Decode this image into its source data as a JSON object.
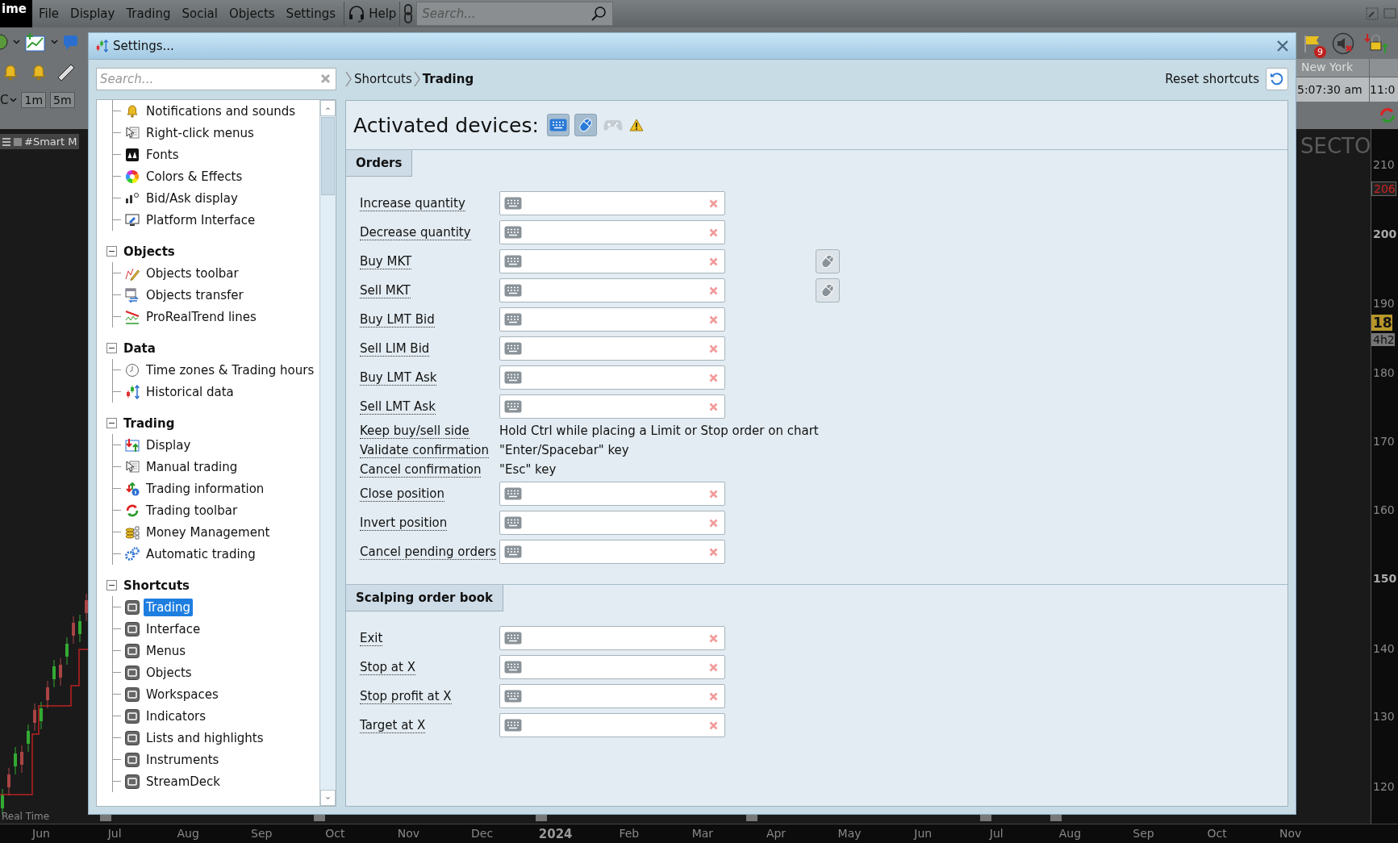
{
  "app": {
    "logo": "ime",
    "menu": [
      "File",
      "Display",
      "Trading",
      "Social",
      "Objects",
      "Settings"
    ],
    "help": "Help",
    "search": {
      "placeholder": "Search..."
    }
  },
  "toolbar": {
    "selector": "C",
    "timeframes": [
      "1m",
      "5m"
    ],
    "chart_name": "#Smart M"
  },
  "market_clock": {
    "badge": "9",
    "city": "New York",
    "time": "5:07:30 am",
    "time_2": "11:0"
  },
  "chart": {
    "watermark": "SECTO",
    "status": "Real Time",
    "price_labels": [
      {
        "kind": "tick",
        "label": "210"
      },
      {
        "kind": "marker",
        "label": "206"
      },
      {
        "kind": "major",
        "label": "200"
      },
      {
        "kind": "tick",
        "label": "190"
      },
      {
        "kind": "last",
        "label": "18"
      },
      {
        "kind": "timer",
        "label": "4h2"
      },
      {
        "kind": "tick",
        "label": "180"
      },
      {
        "kind": "tick",
        "label": "170"
      },
      {
        "kind": "tick",
        "label": "160"
      },
      {
        "kind": "major",
        "label": "150"
      },
      {
        "kind": "tick",
        "label": "140"
      },
      {
        "kind": "tick",
        "label": "130"
      },
      {
        "kind": "tick",
        "label": "120"
      }
    ],
    "date_labels": [
      {
        "kind": "month",
        "label": "Jun"
      },
      {
        "kind": "month",
        "label": "Jul"
      },
      {
        "kind": "month",
        "label": "Aug"
      },
      {
        "kind": "month",
        "label": "Sep"
      },
      {
        "kind": "month",
        "label": "Oct"
      },
      {
        "kind": "month",
        "label": "Nov"
      },
      {
        "kind": "month",
        "label": "Dec"
      },
      {
        "kind": "year",
        "label": "2024"
      },
      {
        "kind": "month",
        "label": "Feb"
      },
      {
        "kind": "month",
        "label": "Mar"
      },
      {
        "kind": "month",
        "label": "Apr"
      },
      {
        "kind": "month",
        "label": "May"
      },
      {
        "kind": "month",
        "label": "Jun"
      },
      {
        "kind": "month",
        "label": "Jul"
      },
      {
        "kind": "month",
        "label": "Aug"
      },
      {
        "kind": "month",
        "label": "Sep"
      },
      {
        "kind": "month",
        "label": "Oct"
      },
      {
        "kind": "month",
        "label": "Nov"
      }
    ]
  },
  "dialog": {
    "title": "Settings...",
    "search": {
      "placeholder": "Search..."
    },
    "tree": [
      {
        "kind": "list",
        "children": [
          {
            "label": "Notifications and sounds",
            "selected": false
          },
          {
            "label": "Right-click menus",
            "selected": false
          },
          {
            "label": "Fonts",
            "selected": false
          },
          {
            "label": "Colors & Effects",
            "selected": false
          },
          {
            "label": "Bid/Ask display",
            "selected": false
          },
          {
            "label": "Platform Interface",
            "selected": false
          }
        ]
      },
      {
        "kind": "group",
        "label": "Objects",
        "expanded": true,
        "children": [
          {
            "label": "Objects toolbar",
            "selected": false
          },
          {
            "label": "Objects transfer",
            "selected": false
          },
          {
            "label": "ProRealTrend lines",
            "selected": false
          }
        ]
      },
      {
        "kind": "group",
        "label": "Data",
        "expanded": true,
        "children": [
          {
            "label": "Time zones & Trading hours",
            "selected": false
          },
          {
            "label": "Historical data",
            "selected": false
          }
        ]
      },
      {
        "kind": "group",
        "label": "Trading",
        "expanded": true,
        "children": [
          {
            "label": "Display",
            "selected": false
          },
          {
            "label": "Manual trading",
            "selected": false
          },
          {
            "label": "Trading information",
            "selected": false
          },
          {
            "label": "Trading toolbar",
            "selected": false
          },
          {
            "label": "Money Management",
            "selected": false
          },
          {
            "label": "Automatic trading",
            "selected": false
          }
        ]
      },
      {
        "kind": "group",
        "label": "Shortcuts",
        "expanded": true,
        "children": [
          {
            "label": "Trading",
            "selected": true
          },
          {
            "label": "Interface",
            "selected": false
          },
          {
            "label": "Menus",
            "selected": false
          },
          {
            "label": "Objects",
            "selected": false
          },
          {
            "label": "Workspaces",
            "selected": false
          },
          {
            "label": "Indicators",
            "selected": false
          },
          {
            "label": "Lists and highlights",
            "selected": false
          },
          {
            "label": "Instruments",
            "selected": false
          },
          {
            "label": "StreamDeck",
            "selected": false
          }
        ]
      }
    ],
    "breadcrumb": [
      "Shortcuts",
      "Trading"
    ],
    "reset_button": "Reset shortcuts",
    "devices": {
      "label": "Activated devices:",
      "warning": true,
      "items": [
        {
          "kind": "keyboard",
          "on": true
        },
        {
          "kind": "mouse",
          "on": true
        },
        {
          "kind": "gamepad",
          "on": false
        }
      ]
    },
    "sections": [
      {
        "title": "Orders",
        "rows": [
          {
            "kind": "shortcut",
            "label": "Increase quantity",
            "mouse_button": false
          },
          {
            "kind": "shortcut",
            "label": "Decrease quantity",
            "mouse_button": false
          },
          {
            "kind": "shortcut",
            "label": "Buy MKT",
            "mouse_button": true
          },
          {
            "kind": "shortcut",
            "label": "Sell MKT",
            "mouse_button": true
          },
          {
            "kind": "shortcut",
            "label": "Buy LMT Bid",
            "mouse_button": false
          },
          {
            "kind": "shortcut",
            "label": "Sell LIM Bid",
            "mouse_button": false
          },
          {
            "kind": "shortcut",
            "label": "Buy LMT Ask",
            "mouse_button": false
          },
          {
            "kind": "shortcut",
            "label": "Sell LMT Ask",
            "mouse_button": false
          },
          {
            "kind": "text",
            "label": "Keep buy/sell side",
            "value": "Hold Ctrl while placing a Limit or Stop order on chart"
          },
          {
            "kind": "text",
            "label": "Validate confirmation",
            "value": "\"Enter/Spacebar\" key"
          },
          {
            "kind": "text",
            "label": "Cancel confirmation",
            "value": "\"Esc\" key"
          },
          {
            "kind": "shortcut",
            "label": "Close position",
            "mouse_button": false
          },
          {
            "kind": "shortcut",
            "label": "Invert position",
            "mouse_button": false
          },
          {
            "kind": "shortcut",
            "label": "Cancel pending orders",
            "mouse_button": false
          }
        ]
      },
      {
        "title": "Scalping order book",
        "rows": [
          {
            "kind": "shortcut",
            "label": "Exit",
            "mouse_button": false
          },
          {
            "kind": "shortcut",
            "label": "Stop at X",
            "mouse_button": false
          },
          {
            "kind": "shortcut",
            "label": "Stop profit at X",
            "mouse_button": false
          },
          {
            "kind": "shortcut",
            "label": "Target at X",
            "mouse_button": false
          }
        ]
      }
    ]
  }
}
